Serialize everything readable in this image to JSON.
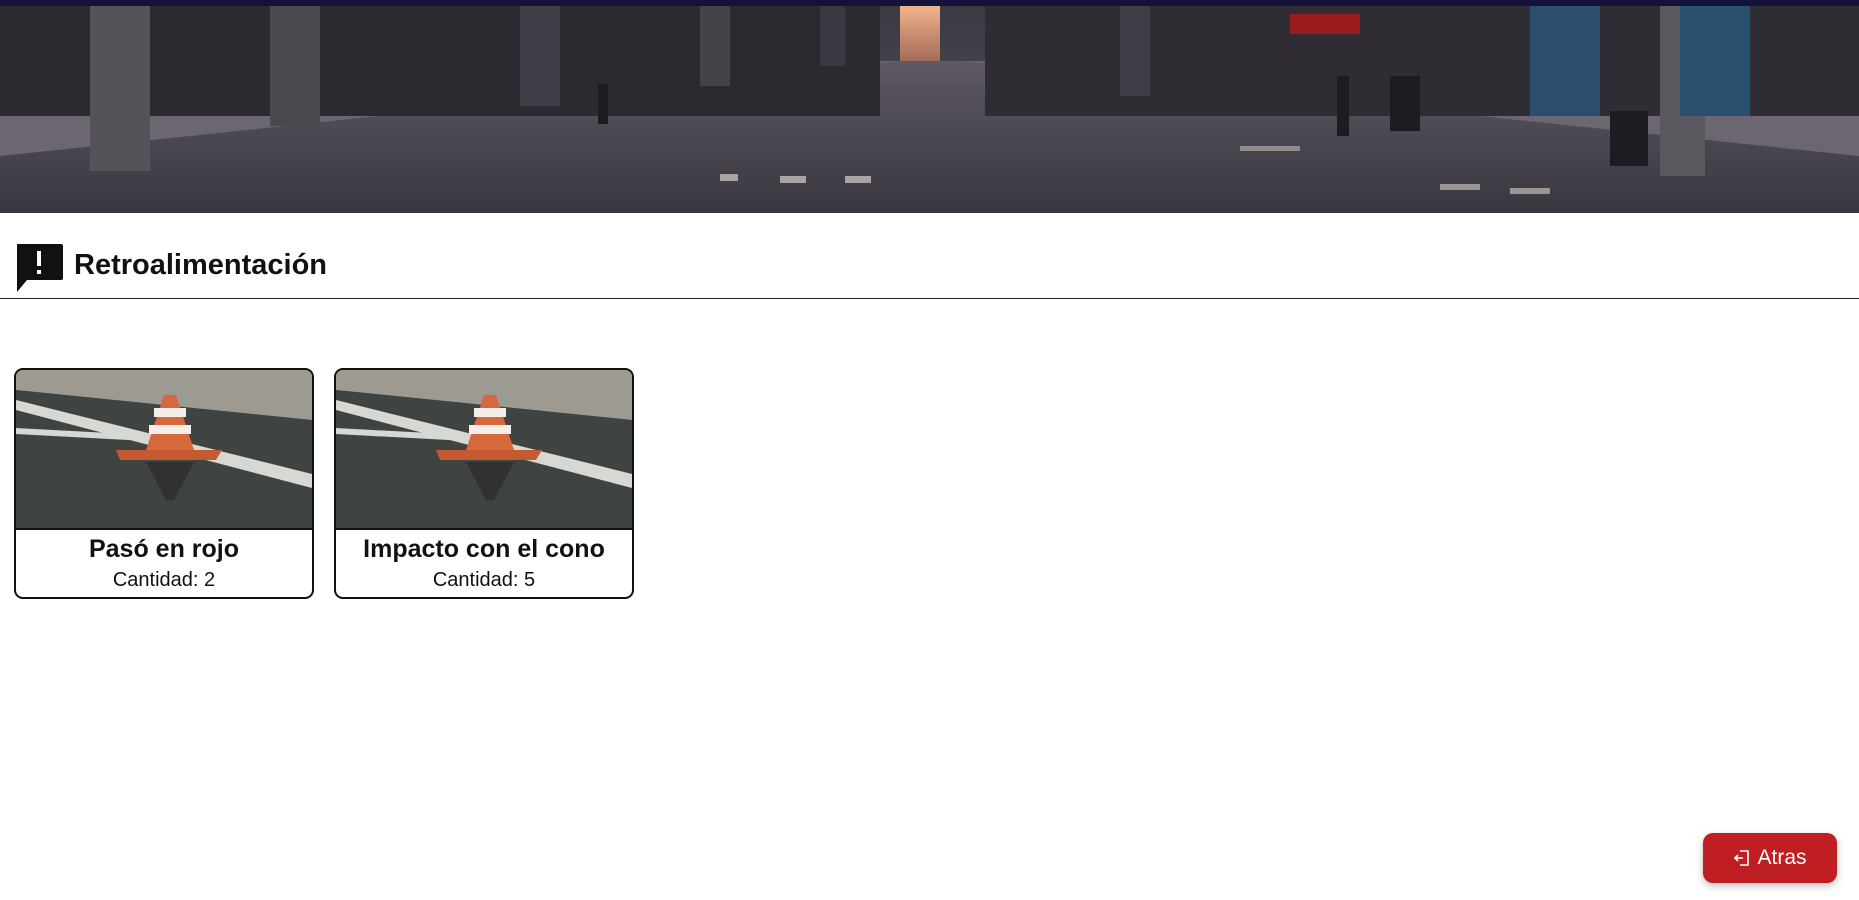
{
  "header": {
    "title": "Retroalimentación"
  },
  "cards": [
    {
      "title": "Pasó en rojo",
      "subtitle": "Cantidad: 2"
    },
    {
      "title": "Impacto con el cono",
      "subtitle": "Cantidad: 5"
    }
  ],
  "actions": {
    "back_label": "Atras"
  },
  "icons": {
    "section": "feedback-alert-icon",
    "back": "exit-door-icon"
  },
  "colors": {
    "top_strip": "#15123a",
    "back_button": "#bf1e22",
    "text": "#111111"
  }
}
